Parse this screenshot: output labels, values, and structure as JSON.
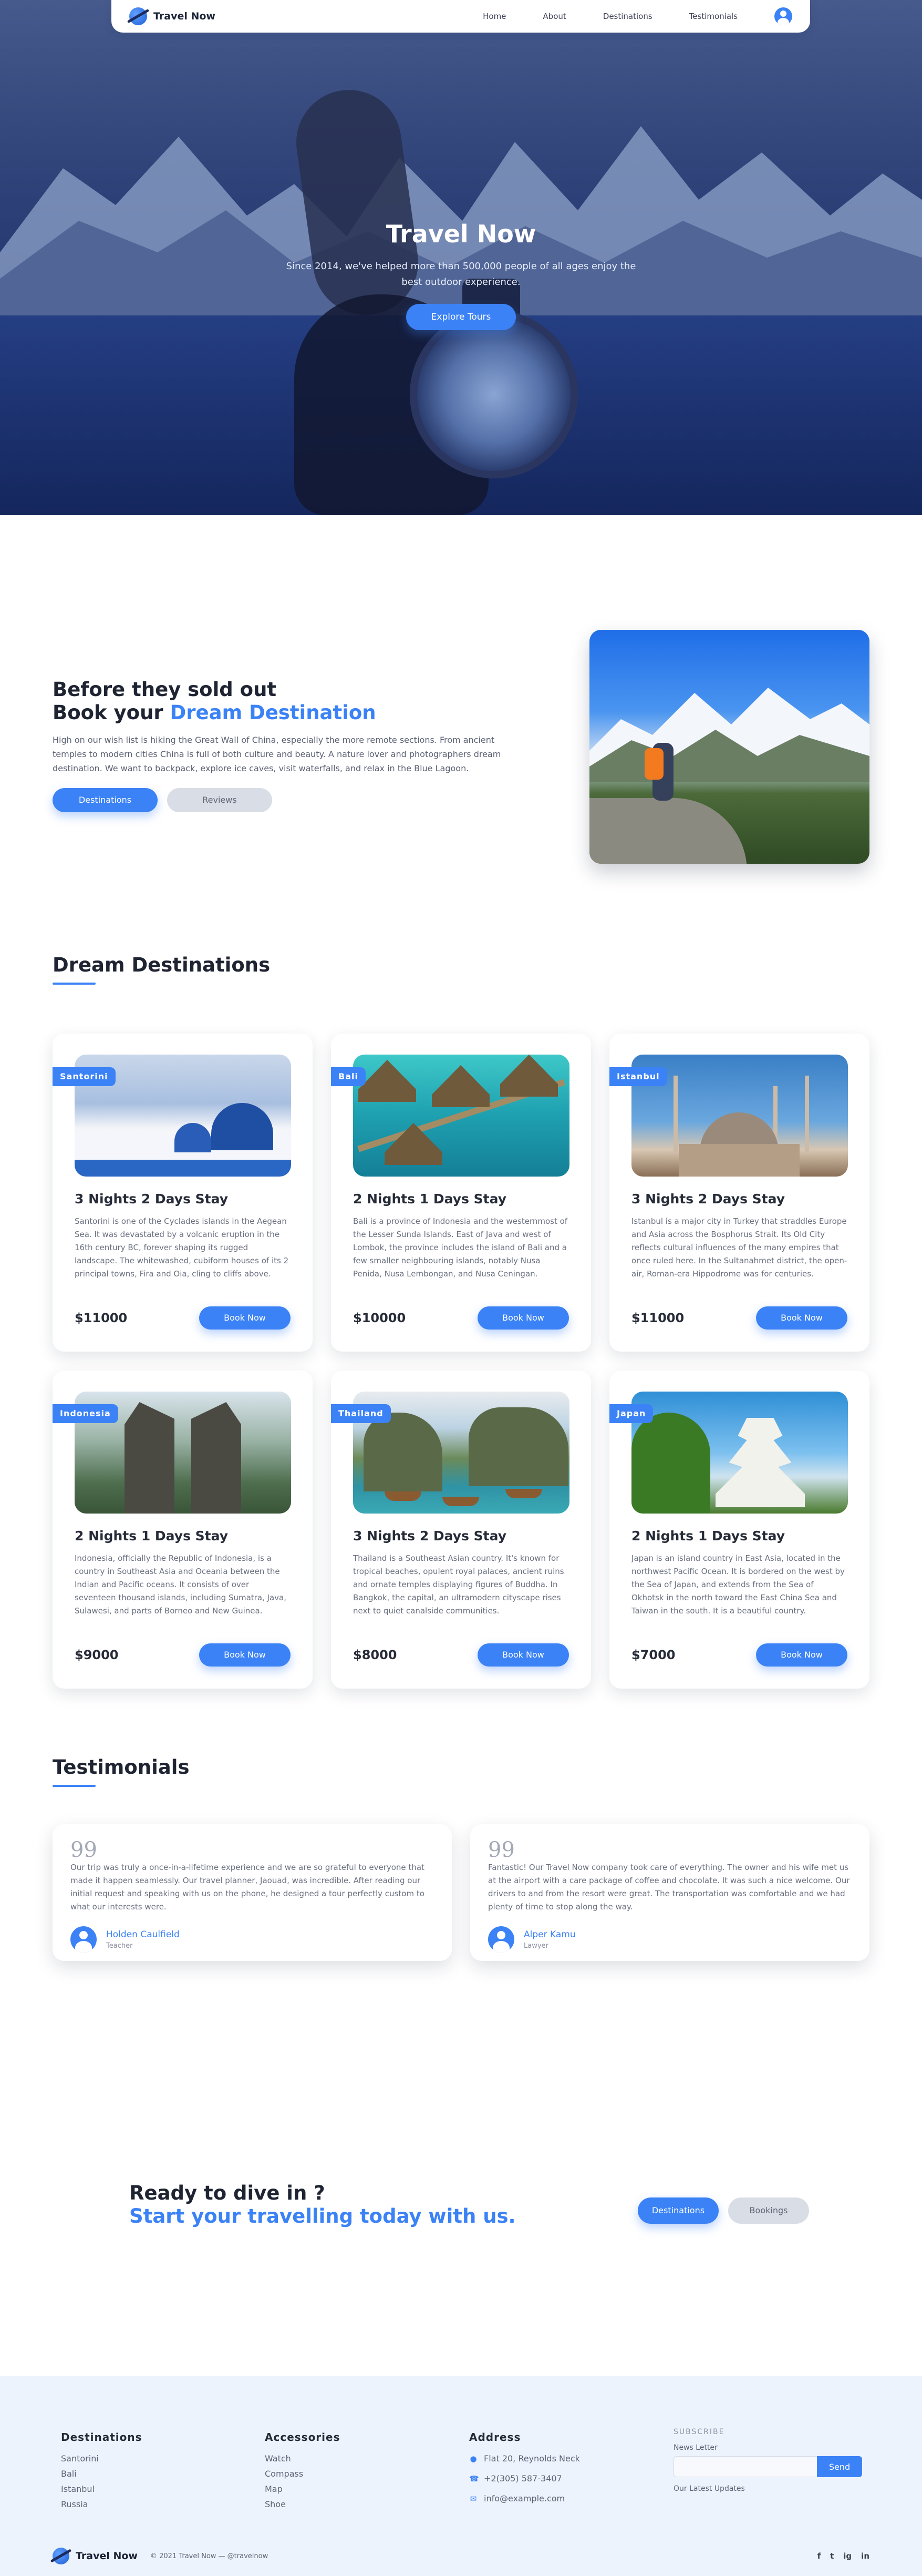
{
  "header": {
    "brand": "Travel Now",
    "nav": [
      "Home",
      "About",
      "Destinations",
      "Testimonials"
    ]
  },
  "hero": {
    "title": "Travel Now",
    "subtitle": "Since 2014, we've helped more than 500,000 people of all ages enjoy the best outdoor experience.",
    "cta": "Explore Tours"
  },
  "intro": {
    "title_line1": "Before they sold out",
    "title_line2_prefix": "Book your ",
    "title_line2_accent": "Dream Destination",
    "description": "High on our wish list is hiking the Great Wall of China, especially the more remote sections. From ancient temples to modern cities China is full of both culture and beauty. A nature lover and photographers dream destination. We want to backpack, explore ice caves, visit waterfalls, and relax in the Blue Lagoon.",
    "button_primary": "Destinations",
    "button_secondary": "Reviews"
  },
  "destinations": {
    "heading": "Dream Destinations",
    "book_label": "Book Now",
    "cards": [
      {
        "tag": "Santorini",
        "title": "3 Nights 2 Days Stay",
        "description": "Santorini is one of the Cyclades islands in the Aegean Sea. It was devastated by a volcanic eruption in the 16th century BC, forever shaping its rugged landscape. The whitewashed, cubiform houses of its 2 principal towns, Fira and Oia, cling to cliffs above.",
        "price": "$11000"
      },
      {
        "tag": "Bali",
        "title": "2 Nights 1 Days Stay",
        "description": "Bali is a province of Indonesia and the westernmost of the Lesser Sunda Islands. East of Java and west of Lombok, the province includes the island of Bali and a few smaller neighbouring islands, notably Nusa Penida, Nusa Lembongan, and Nusa Ceningan.",
        "price": "$10000"
      },
      {
        "tag": "Istanbul",
        "title": "3 Nights 2 Days Stay",
        "description": "Istanbul is a major city in Turkey that straddles Europe and Asia across the Bosphorus Strait. Its Old City reflects cultural influences of the many empires that once ruled here. In the Sultanahmet district, the open-air, Roman-era Hippodrome was for centuries.",
        "price": "$11000"
      },
      {
        "tag": "Indonesia",
        "title": "2 Nights 1 Days Stay",
        "description": "Indonesia, officially the Republic of Indonesia, is a country in Southeast Asia and Oceania between the Indian and Pacific oceans. It consists of over seventeen thousand islands, including Sumatra, Java, Sulawesi, and parts of Borneo and New Guinea.",
        "price": "$9000"
      },
      {
        "tag": "Thailand",
        "title": "3 Nights 2 Days Stay",
        "description": "Thailand is a Southeast Asian country. It's known for tropical beaches, opulent royal palaces, ancient ruins and ornate temples displaying figures of Buddha. In Bangkok, the capital, an ultramodern cityscape rises next to quiet canalside communities.",
        "price": "$8000"
      },
      {
        "tag": "Japan",
        "title": "2 Nights 1 Days Stay",
        "description": "Japan is an island country in East Asia, located in the northwest Pacific Ocean. It is bordered on the west by the Sea of Japan, and extends from the Sea of Okhotsk in the north toward the East China Sea and Taiwan in the south. It is a beautiful country.",
        "price": "$7000"
      }
    ]
  },
  "testimonials": {
    "heading": "Testimonials",
    "quote_mark": "99",
    "items": [
      {
        "text": "Our trip was truly a once-in-a-lifetime experience and we are so grateful to everyone that made it happen seamlessly. Our travel planner, Jaouad, was incredible. After reading our initial request and speaking with us on the phone, he designed a tour perfectly custom to what our interests were.",
        "name": "Holden Caulfield",
        "role": "Teacher"
      },
      {
        "text": "Fantastic! Our Travel Now company took care of everything. The owner and his wife met us at the airport with a care package of coffee and chocolate. It was such a nice welcome. Our drivers to and from the resort were great. The transportation was comfortable and we had plenty of time to stop along the way.",
        "name": "Alper Kamu",
        "role": "Lawyer"
      }
    ]
  },
  "cta": {
    "line1": "Ready to dive in ?",
    "line2": "Start your travelling today with us.",
    "button_primary": "Destinations",
    "button_secondary": "Bookings"
  },
  "footer": {
    "destinations": {
      "heading": "Destinations",
      "items": [
        "Santorini",
        "Bali",
        "Istanbul",
        "Russia"
      ]
    },
    "accessories": {
      "heading": "Accessories",
      "items": [
        "Watch",
        "Compass",
        "Map",
        "Shoe"
      ]
    },
    "address": {
      "heading": "Address",
      "street": "Flat 20, Reynolds Neck",
      "phone": "+2(305) 587-3407",
      "email": "info@example.com"
    },
    "subscribe": {
      "heading": "SUBSCRIBE",
      "label": "News Letter",
      "placeholder": "",
      "button": "Send",
      "footnote": "Our Latest Updates"
    },
    "brand": "Travel Now",
    "copyright": "© 2021 Travel Now — @travelnow",
    "socials": [
      "f",
      "t",
      "ig",
      "in"
    ]
  },
  "colors": {
    "accent": "#3b82f6",
    "heading": "#1f2433",
    "footer_bg": "#edf3fc"
  }
}
